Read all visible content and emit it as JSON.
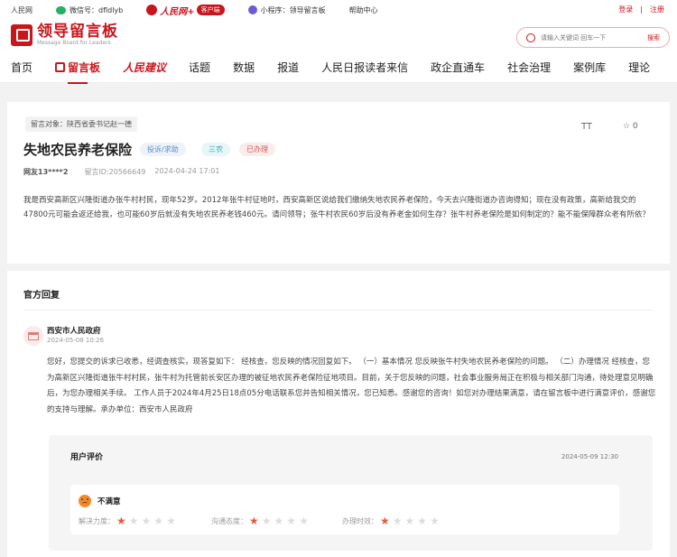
{
  "topbar": {
    "site": "人民网",
    "wechat": "微信号：dfldlyb",
    "app_logo": "人民网+",
    "app_badge": "客户端",
    "miniprogram": "小程序：领导留言板",
    "help": "帮助中心",
    "login": "登录",
    "sep": "|",
    "register": "注册"
  },
  "header": {
    "logo_title": "领导留言板",
    "logo_sub": "Message Board for Leaders",
    "search_placeholder": "请输入关键词 回车一下",
    "search_button": "搜索"
  },
  "nav": [
    "首页",
    "留言板",
    "人民建议",
    "话题",
    "数据",
    "报道",
    "人民日报读者来信",
    "政企直通车",
    "社会治理",
    "案例库",
    "理论"
  ],
  "message": {
    "target": "留言对象：陕西省委书记赵一德",
    "title": "失地农民养老保险",
    "tags": [
      "投诉/求助",
      "三农",
      "已办理"
    ],
    "author": "网友13****2",
    "message_id": "留言ID:20566649",
    "date": "2024-04-24 17:01",
    "font_toggle": "TT",
    "favorites": "☆ 0",
    "content": "我是西安高新区兴隆街道办张牛村村民，现年52岁。2012年张牛村征地时，西安高新区说给我们缴纳失地农民养老保险，今天去兴隆街道办咨询得知；现在没有政策，高新给我交的47800元可能会返还给我，也可能60岁后就没有失地农民养老钱460元。请问领导；张牛村农民60岁后没有养老金如何生存？张牛村养老保险是如何制定的？能不能保障群众老有所依？"
  },
  "reply": {
    "section_title": "官方回复",
    "org": "西安市人民政府",
    "date": "2024-05-08 10:26",
    "content": "您好，您提交的诉求已收悉，经调查核实，现答复如下： 经核查，您反映的情况回复如下。 （一）基本情况 您反映张牛村失地农民养老保险的问题。 （二）办理情况 经核查，您为高新区兴隆街道张牛村村民，张牛村为托管前长安区办理的被征地农民养老保险征地项目。目前，关于您反映的问题，社会事业服务局正在积极与相关部门沟通，待处理意见明确后，为您办理相关手续。 工作人员于2024年4月25日18点05分电话联系您并告知相关情况，您已知悉。感谢您的咨询！如您对办理结果满意，请在留言板中进行满意评价，感谢您的支持与理解。承办单位：西安市人民政府"
  },
  "evaluation": {
    "title": "用户评价",
    "date": "2024-05-09 12:30",
    "verdict": "不满意",
    "ratings": [
      {
        "label": "解决力度：",
        "value": 1,
        "max": 5
      },
      {
        "label": "沟通态度：",
        "value": 1,
        "max": 5
      },
      {
        "label": "办理时效：",
        "value": 1,
        "max": 5
      }
    ]
  },
  "colors": {
    "accent": "#c8161d",
    "star_on": "#e25b3b",
    "star_off": "#dddddd"
  }
}
